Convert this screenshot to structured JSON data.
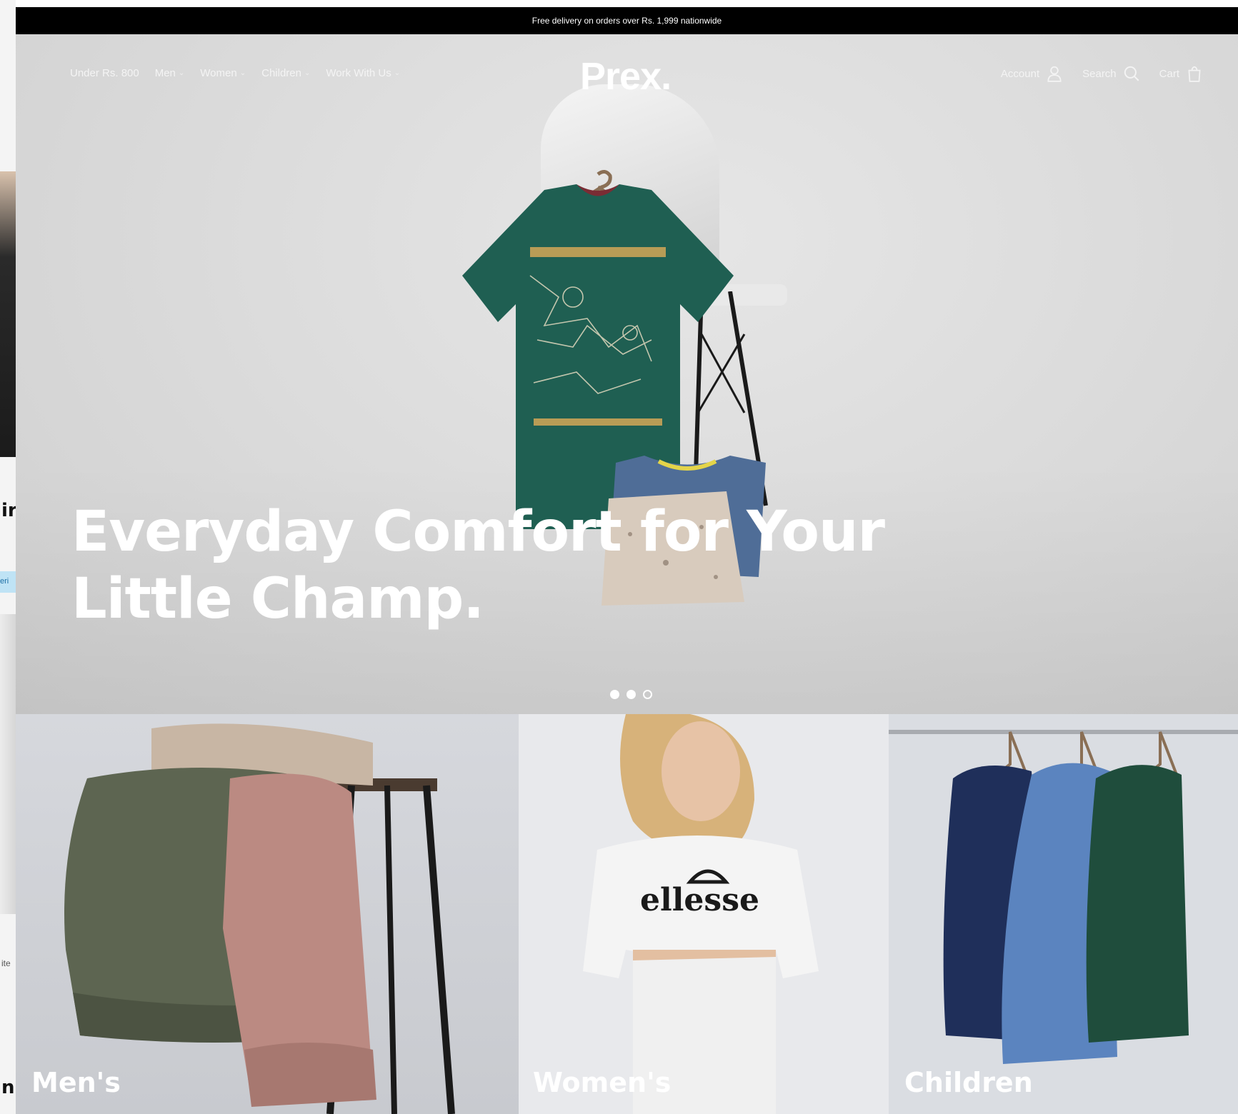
{
  "announcement": "Free delivery on orders over Rs. 1,999 nationwide",
  "header": {
    "brand": "Prex.",
    "nav": [
      {
        "label": "Under Rs. 800",
        "has_dropdown": false
      },
      {
        "label": "Men",
        "has_dropdown": true
      },
      {
        "label": "Women",
        "has_dropdown": true
      },
      {
        "label": "Children",
        "has_dropdown": true
      },
      {
        "label": "Work With Us",
        "has_dropdown": true
      }
    ],
    "utilities": {
      "account": "Account",
      "search": "Search",
      "cart": "Cart"
    }
  },
  "hero": {
    "line1": "Everyday Comfort for Your",
    "line2": "Little Champ.",
    "slides": 3,
    "active_slide": 2
  },
  "categories": [
    {
      "label": "Men's"
    },
    {
      "label": "Women's"
    },
    {
      "label": "Children"
    }
  ],
  "side_fragment": {
    "letter_top": "ir",
    "pill": "eri",
    "small": "ite",
    "letter_bottom": "n"
  },
  "colors": {
    "announcement_bg": "#000000",
    "tee_green": "#1f5f52",
    "hero_text": "#ffffff"
  }
}
